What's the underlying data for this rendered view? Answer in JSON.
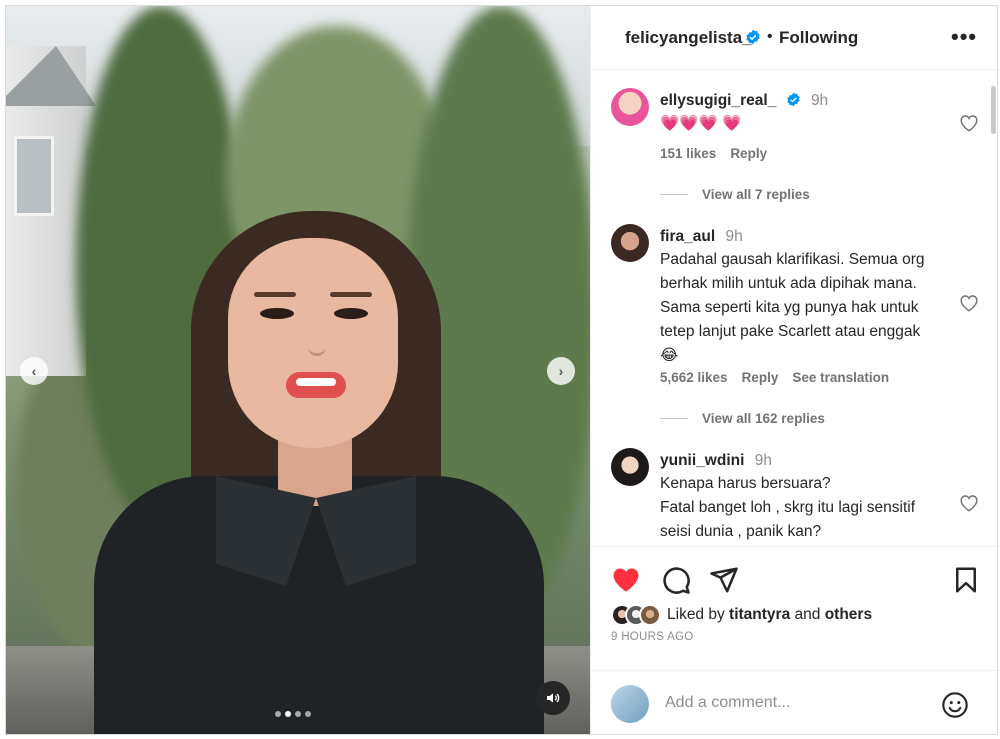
{
  "header": {
    "username": "felicyangelista_",
    "separator": "•",
    "follow_status": "Following",
    "more_label": "•••"
  },
  "media": {
    "prev_label": "‹",
    "next_label": "›",
    "carousel_count": 4,
    "carousel_active": 2
  },
  "comments": [
    {
      "username": "ellysugigi_real_",
      "verified": true,
      "time": "9h",
      "text": "💗💗💗 💗",
      "likes": "151 likes",
      "reply": "Reply",
      "view_replies": "View all 7 replies"
    },
    {
      "username": "fira_aul",
      "verified": false,
      "time": "9h",
      "text": "Padahal gausah klarifikasi. Semua org\nberhak milih untuk ada dipihak mana.\nSama seperti kita yg punya hak untuk\ntetep lanjut pake Scarlett atau enggak\n😂",
      "likes": "5,662 likes",
      "reply": "Reply",
      "translation": "See translation",
      "view_replies": "View all 162 replies"
    },
    {
      "username": "yunii_wdini",
      "verified": false,
      "time": "9h",
      "text": "Kenapa harus bersuara?\nFatal banget loh , skrg itu lagi sensitif\nseisi dunia , panik kan?"
    }
  ],
  "actions": {
    "liked_prefix": "Liked by",
    "liked_user": "titantyra",
    "liked_and": "and",
    "liked_others": "others",
    "time_ago": "9 HOURS AGO"
  },
  "add_comment": {
    "placeholder": "Add a comment..."
  },
  "colors": {
    "heart_red": "#ff3040",
    "verified_blue": "#0095f6",
    "muted": "#737373"
  }
}
